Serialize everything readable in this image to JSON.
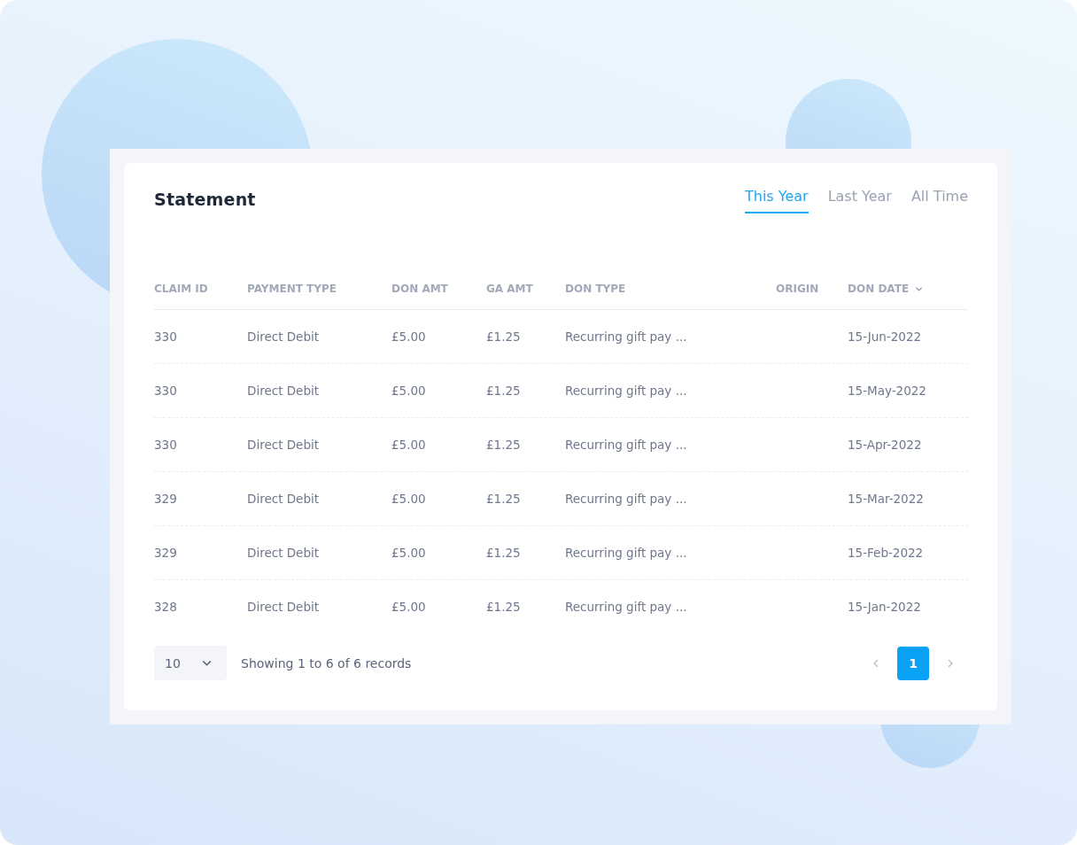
{
  "card": {
    "title": "Statement"
  },
  "tabs": [
    {
      "label": "This Year",
      "selected": true
    },
    {
      "label": "Last Year",
      "selected": false
    },
    {
      "label": "All Time",
      "selected": false
    }
  ],
  "table": {
    "columns": [
      {
        "label": "CLAIM ID",
        "sorted": false
      },
      {
        "label": "PAYMENT TYPE",
        "sorted": false
      },
      {
        "label": "DON AMT",
        "sorted": false
      },
      {
        "label": "GA AMT",
        "sorted": false
      },
      {
        "label": "DON TYPE",
        "sorted": false
      },
      {
        "label": "ORIGIN",
        "sorted": false
      },
      {
        "label": "DON DATE",
        "sorted": true
      }
    ],
    "rows": [
      [
        "330",
        "Direct Debit",
        "£5.00",
        "£1.25",
        "Recurring gift pay ...",
        "",
        "15-Jun-2022"
      ],
      [
        "330",
        "Direct Debit",
        "£5.00",
        "£1.25",
        "Recurring gift pay ...",
        "",
        "15-May-2022"
      ],
      [
        "330",
        "Direct Debit",
        "£5.00",
        "£1.25",
        "Recurring gift pay ...",
        "",
        "15-Apr-2022"
      ],
      [
        "329",
        "Direct Debit",
        "£5.00",
        "£1.25",
        "Recurring gift pay ...",
        "",
        "15-Mar-2022"
      ],
      [
        "329",
        "Direct Debit",
        "£5.00",
        "£1.25",
        "Recurring gift pay ...",
        "",
        "15-Feb-2022"
      ],
      [
        "328",
        "Direct Debit",
        "£5.00",
        "£1.25",
        "Recurring gift pay ...",
        "",
        "15-Jan-2022"
      ]
    ]
  },
  "footer": {
    "page_size": "10",
    "summary": "Showing 1 to 6 of 6 records",
    "pages": [
      {
        "label": "1",
        "selected": true
      }
    ]
  }
}
